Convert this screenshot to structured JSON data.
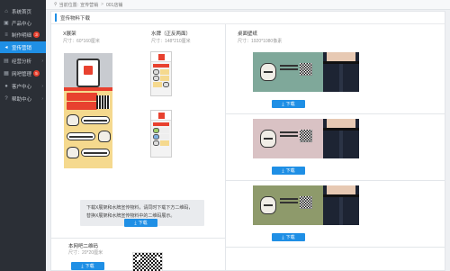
{
  "sidebar": {
    "items": [
      {
        "label": "系统首页",
        "icon": "home-icon",
        "glyph": "⌂"
      },
      {
        "label": "产品中心",
        "icon": "cube-icon",
        "glyph": "▣"
      },
      {
        "label": "制作明细",
        "icon": "list-icon",
        "glyph": "≡",
        "badge": "3"
      },
      {
        "label": "宣传营销",
        "icon": "megaphone-icon",
        "glyph": "◂",
        "active": true
      },
      {
        "label": "经营分析",
        "icon": "chart-icon",
        "glyph": "▤"
      },
      {
        "label": "网吧管理",
        "icon": "shop-icon",
        "glyph": "▦",
        "badge": "5"
      },
      {
        "label": "客户中心",
        "icon": "user-icon",
        "glyph": "●"
      },
      {
        "label": "帮助中心",
        "icon": "help-icon",
        "glyph": "?"
      }
    ]
  },
  "breadcrumb": {
    "prefix": "当前位置:",
    "section": "宣传营销",
    "page": "001店铺"
  },
  "panel": {
    "title": "宣传物料下载"
  },
  "xstand": {
    "name": "X展架",
    "size": "尺寸：60*160厘米"
  },
  "watersign": {
    "name": "水牌（正反两面）",
    "size": "尺寸：148*210厘米"
  },
  "info": {
    "line1": "下载X展架和水牌宣传物料，请同时下载下方二维码，",
    "line2": "替换X展架和水牌宣传物料中的二维码展示。"
  },
  "download_label": "下载",
  "qrcode": {
    "name": "本网吧二维码",
    "size": "尺寸：20*20厘米"
  },
  "wallpaper": {
    "name": "桌面壁纸",
    "size": "尺寸：1920*1080像素"
  },
  "colors": {
    "accent": "#1f8fe5",
    "sidebar_bg": "#2b2f36",
    "badge": "#e8412f",
    "wallpaper_1": "#7fa89a",
    "wallpaper_2": "#d9c2c4",
    "wallpaper_3": "#8e9a6b"
  }
}
